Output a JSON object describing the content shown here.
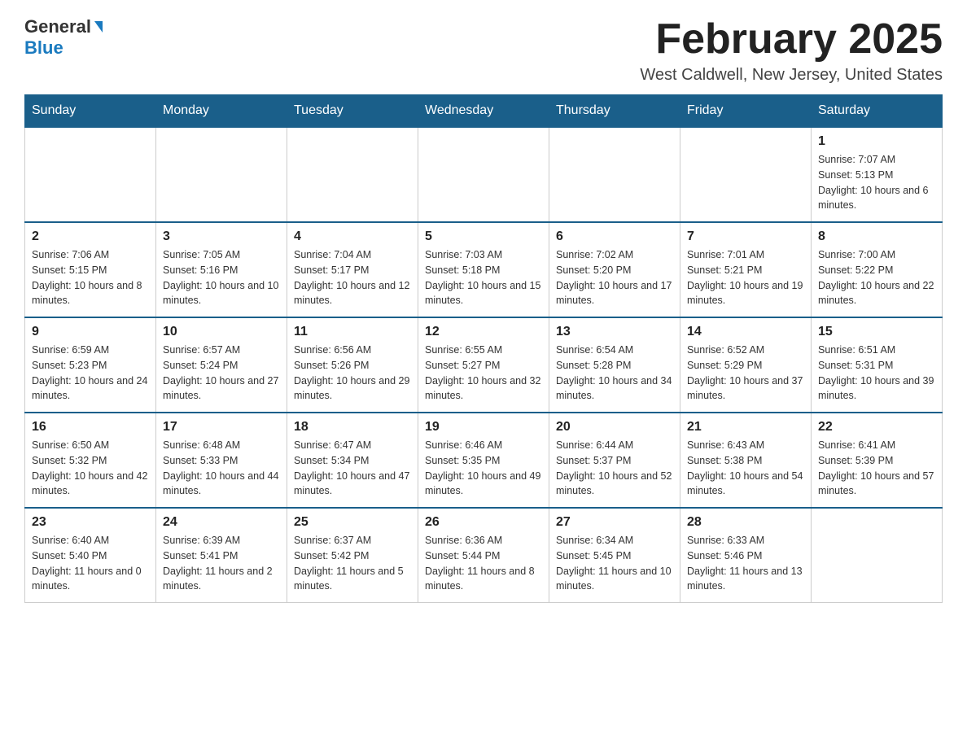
{
  "logo": {
    "general": "General",
    "blue": "Blue"
  },
  "header": {
    "title": "February 2025",
    "subtitle": "West Caldwell, New Jersey, United States"
  },
  "weekdays": [
    "Sunday",
    "Monday",
    "Tuesday",
    "Wednesday",
    "Thursday",
    "Friday",
    "Saturday"
  ],
  "weeks": [
    [
      {
        "day": "",
        "info": ""
      },
      {
        "day": "",
        "info": ""
      },
      {
        "day": "",
        "info": ""
      },
      {
        "day": "",
        "info": ""
      },
      {
        "day": "",
        "info": ""
      },
      {
        "day": "",
        "info": ""
      },
      {
        "day": "1",
        "info": "Sunrise: 7:07 AM\nSunset: 5:13 PM\nDaylight: 10 hours and 6 minutes."
      }
    ],
    [
      {
        "day": "2",
        "info": "Sunrise: 7:06 AM\nSunset: 5:15 PM\nDaylight: 10 hours and 8 minutes."
      },
      {
        "day": "3",
        "info": "Sunrise: 7:05 AM\nSunset: 5:16 PM\nDaylight: 10 hours and 10 minutes."
      },
      {
        "day": "4",
        "info": "Sunrise: 7:04 AM\nSunset: 5:17 PM\nDaylight: 10 hours and 12 minutes."
      },
      {
        "day": "5",
        "info": "Sunrise: 7:03 AM\nSunset: 5:18 PM\nDaylight: 10 hours and 15 minutes."
      },
      {
        "day": "6",
        "info": "Sunrise: 7:02 AM\nSunset: 5:20 PM\nDaylight: 10 hours and 17 minutes."
      },
      {
        "day": "7",
        "info": "Sunrise: 7:01 AM\nSunset: 5:21 PM\nDaylight: 10 hours and 19 minutes."
      },
      {
        "day": "8",
        "info": "Sunrise: 7:00 AM\nSunset: 5:22 PM\nDaylight: 10 hours and 22 minutes."
      }
    ],
    [
      {
        "day": "9",
        "info": "Sunrise: 6:59 AM\nSunset: 5:23 PM\nDaylight: 10 hours and 24 minutes."
      },
      {
        "day": "10",
        "info": "Sunrise: 6:57 AM\nSunset: 5:24 PM\nDaylight: 10 hours and 27 minutes."
      },
      {
        "day": "11",
        "info": "Sunrise: 6:56 AM\nSunset: 5:26 PM\nDaylight: 10 hours and 29 minutes."
      },
      {
        "day": "12",
        "info": "Sunrise: 6:55 AM\nSunset: 5:27 PM\nDaylight: 10 hours and 32 minutes."
      },
      {
        "day": "13",
        "info": "Sunrise: 6:54 AM\nSunset: 5:28 PM\nDaylight: 10 hours and 34 minutes."
      },
      {
        "day": "14",
        "info": "Sunrise: 6:52 AM\nSunset: 5:29 PM\nDaylight: 10 hours and 37 minutes."
      },
      {
        "day": "15",
        "info": "Sunrise: 6:51 AM\nSunset: 5:31 PM\nDaylight: 10 hours and 39 minutes."
      }
    ],
    [
      {
        "day": "16",
        "info": "Sunrise: 6:50 AM\nSunset: 5:32 PM\nDaylight: 10 hours and 42 minutes."
      },
      {
        "day": "17",
        "info": "Sunrise: 6:48 AM\nSunset: 5:33 PM\nDaylight: 10 hours and 44 minutes."
      },
      {
        "day": "18",
        "info": "Sunrise: 6:47 AM\nSunset: 5:34 PM\nDaylight: 10 hours and 47 minutes."
      },
      {
        "day": "19",
        "info": "Sunrise: 6:46 AM\nSunset: 5:35 PM\nDaylight: 10 hours and 49 minutes."
      },
      {
        "day": "20",
        "info": "Sunrise: 6:44 AM\nSunset: 5:37 PM\nDaylight: 10 hours and 52 minutes."
      },
      {
        "day": "21",
        "info": "Sunrise: 6:43 AM\nSunset: 5:38 PM\nDaylight: 10 hours and 54 minutes."
      },
      {
        "day": "22",
        "info": "Sunrise: 6:41 AM\nSunset: 5:39 PM\nDaylight: 10 hours and 57 minutes."
      }
    ],
    [
      {
        "day": "23",
        "info": "Sunrise: 6:40 AM\nSunset: 5:40 PM\nDaylight: 11 hours and 0 minutes."
      },
      {
        "day": "24",
        "info": "Sunrise: 6:39 AM\nSunset: 5:41 PM\nDaylight: 11 hours and 2 minutes."
      },
      {
        "day": "25",
        "info": "Sunrise: 6:37 AM\nSunset: 5:42 PM\nDaylight: 11 hours and 5 minutes."
      },
      {
        "day": "26",
        "info": "Sunrise: 6:36 AM\nSunset: 5:44 PM\nDaylight: 11 hours and 8 minutes."
      },
      {
        "day": "27",
        "info": "Sunrise: 6:34 AM\nSunset: 5:45 PM\nDaylight: 11 hours and 10 minutes."
      },
      {
        "day": "28",
        "info": "Sunrise: 6:33 AM\nSunset: 5:46 PM\nDaylight: 11 hours and 13 minutes."
      },
      {
        "day": "",
        "info": ""
      }
    ]
  ]
}
